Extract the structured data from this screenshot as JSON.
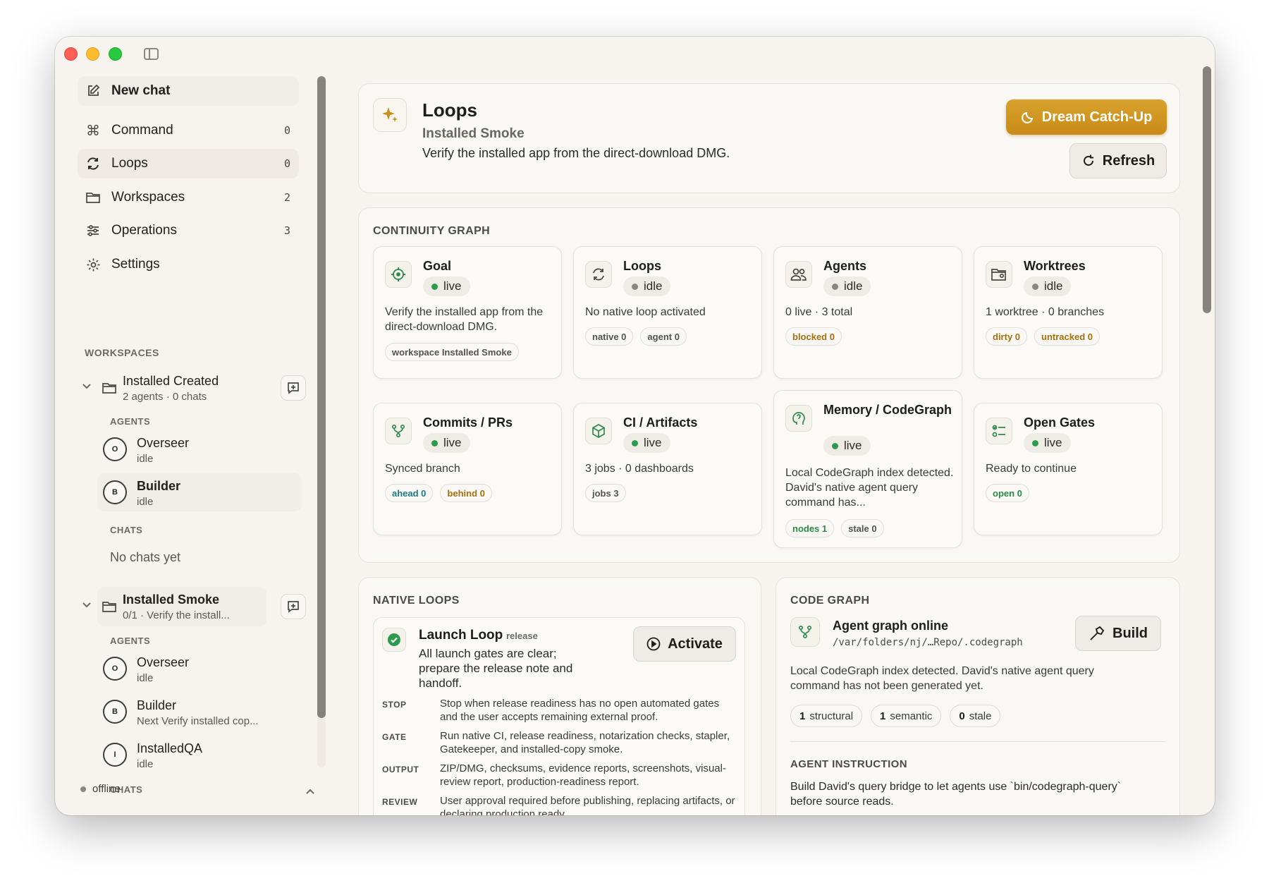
{
  "sidebar": {
    "new_chat": "New chat",
    "nav": [
      {
        "label": "Command",
        "count": "0"
      },
      {
        "label": "Loops",
        "count": "0"
      },
      {
        "label": "Workspaces",
        "count": "2"
      },
      {
        "label": "Operations",
        "count": "3"
      },
      {
        "label": "Settings",
        "count": ""
      }
    ],
    "workspaces_label": "WORKSPACES",
    "workspaces": [
      {
        "title": "Installed Created",
        "subtitle": "2 agents · 0 chats",
        "agents_label": "AGENTS",
        "agents": [
          {
            "initial": "O",
            "name": "Overseer",
            "status": "idle"
          },
          {
            "initial": "B",
            "name": "Builder",
            "status": "idle"
          }
        ],
        "chats_label": "CHATS",
        "no_chats": "No chats yet"
      },
      {
        "title": "Installed Smoke",
        "subtitle": "0/1 · Verify the install...",
        "agents_label": "AGENTS",
        "agents": [
          {
            "initial": "O",
            "name": "Overseer",
            "status": "idle"
          },
          {
            "initial": "B",
            "name": "Builder",
            "status": "Next Verify installed cop..."
          },
          {
            "initial": "I",
            "name": "InstalledQA",
            "status": "idle"
          }
        ],
        "chats_label": "CHATS"
      }
    ],
    "status": "offline"
  },
  "header": {
    "title": "Loops",
    "subtitle": "Installed Smoke",
    "description": "Verify the installed app from the direct-download DMG.",
    "dream_button": "Dream Catch-Up",
    "refresh_button": "Refresh"
  },
  "continuity": {
    "heading": "CONTINUITY GRAPH",
    "cards": [
      {
        "title": "Goal",
        "status": "live",
        "desc": "Verify the installed app from the direct-download DMG.",
        "tags": [
          {
            "text": "workspace Installed Smoke",
            "tone": "neutral"
          }
        ]
      },
      {
        "title": "Loops",
        "status": "idle",
        "desc": "No native loop activated",
        "tags": [
          {
            "text": "native 0",
            "tone": "neutral"
          },
          {
            "text": "agent 0",
            "tone": "neutral"
          }
        ]
      },
      {
        "title": "Agents",
        "status": "idle",
        "desc": "0 live · 3 total",
        "tags": [
          {
            "text": "blocked 0",
            "tone": "amber"
          }
        ]
      },
      {
        "title": "Worktrees",
        "status": "idle",
        "desc": "1 worktree · 0 branches",
        "tags": [
          {
            "text": "dirty 0",
            "tone": "amber"
          },
          {
            "text": "untracked 0",
            "tone": "amber"
          }
        ]
      },
      {
        "title": "Commits / PRs",
        "status": "live",
        "desc": "Synced branch",
        "tags": [
          {
            "text": "ahead 0",
            "tone": "teal"
          },
          {
            "text": "behind 0",
            "tone": "amber"
          }
        ]
      },
      {
        "title": "CI / Artifacts",
        "status": "live",
        "desc": "3 jobs · 0 dashboards",
        "tags": [
          {
            "text": "jobs 3",
            "tone": "neutral"
          }
        ]
      },
      {
        "title": "Memory / CodeGraph",
        "status": "live",
        "desc": "Local CodeGraph index detected. David's native agent query command has...",
        "tags": [
          {
            "text": "nodes 1",
            "tone": "green"
          },
          {
            "text": "stale 0",
            "tone": "neutral"
          }
        ]
      },
      {
        "title": "Open Gates",
        "status": "live",
        "desc": "Ready to continue",
        "tags": [
          {
            "text": "open 0",
            "tone": "green"
          }
        ]
      }
    ]
  },
  "native_loops": {
    "heading": "NATIVE LOOPS",
    "loop": {
      "title": "Launch Loop",
      "badge": "release",
      "desc": "All launch gates are clear; prepare the release note and handoff.",
      "activate_button": "Activate",
      "rows": [
        {
          "key": "STOP",
          "value": "Stop when release readiness has no open automated gates and the user accepts remaining external proof."
        },
        {
          "key": "GATE",
          "value": "Run native CI, release readiness, notarization checks, stapler, Gatekeeper, and installed-copy smoke."
        },
        {
          "key": "OUTPUT",
          "value": "ZIP/DMG, checksums, evidence reports, screenshots, visual-review report, production-readiness report."
        },
        {
          "key": "REVIEW",
          "value": "User approval required before publishing, replacing artifacts, or declaring production ready."
        }
      ]
    }
  },
  "code_graph": {
    "heading": "CODE GRAPH",
    "title": "Agent graph online",
    "path": "/var/folders/nj/…Repo/.codegraph",
    "build_button": "Build",
    "desc": "Local CodeGraph index detected. David's native agent query command has not been generated yet.",
    "stats": [
      {
        "num": "1",
        "label": "structural"
      },
      {
        "num": "1",
        "label": "semantic"
      },
      {
        "num": "0",
        "label": "stale"
      }
    ],
    "instruction_heading": "AGENT INSTRUCTION",
    "instruction": "Build David's query bridge to let agents use `bin/codegraph-query` before source reads."
  },
  "colors": {
    "accent": "#d19a25",
    "live": "#2e9a4e",
    "idle": "#8a8782",
    "background": "#f7f4ef"
  }
}
